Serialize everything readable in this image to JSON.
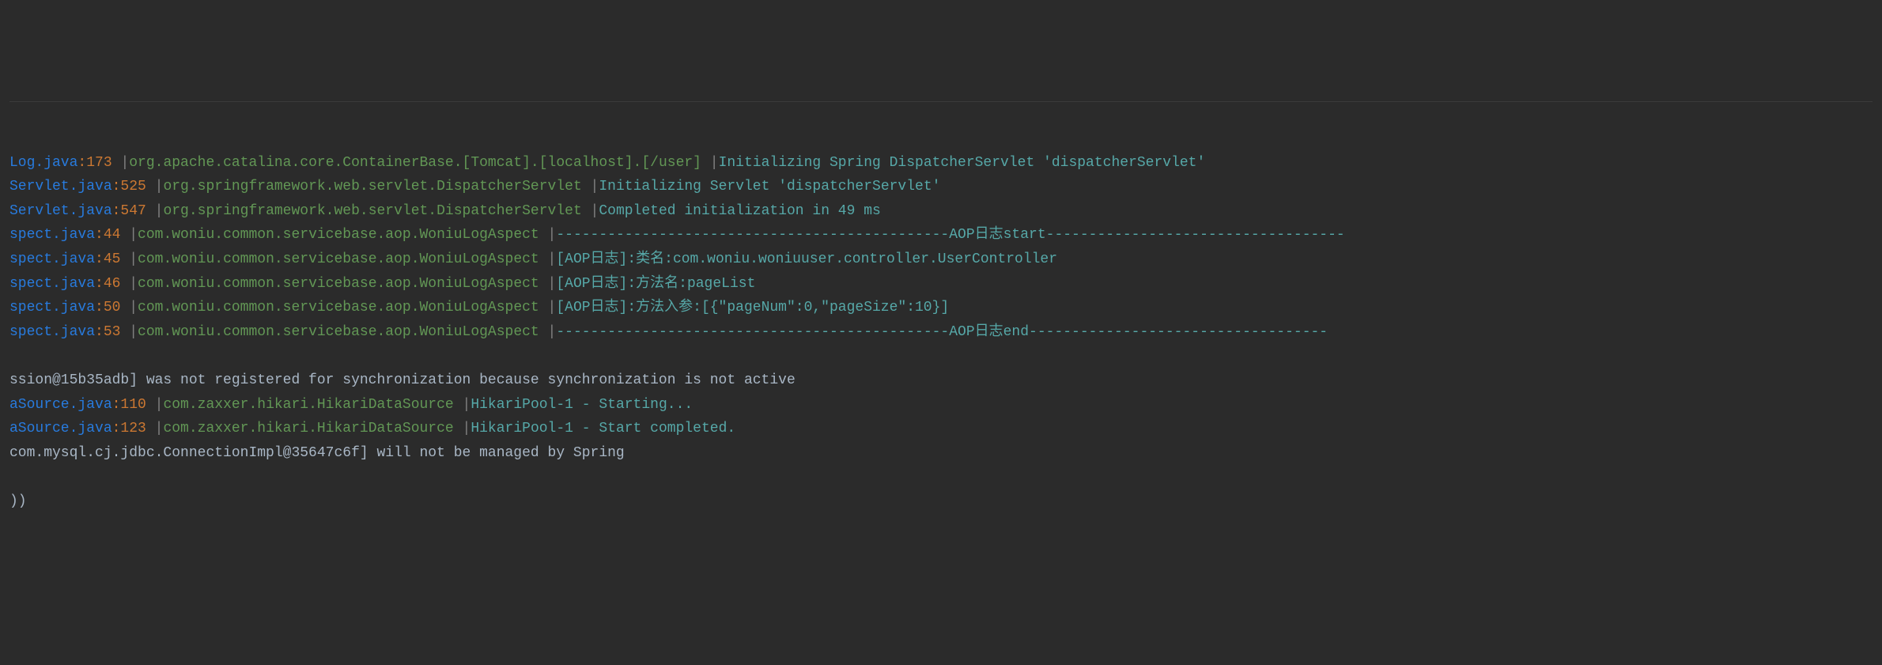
{
  "lines": [
    {
      "file": "Log.java",
      "lineNum": ":173",
      "logger": "org.apache.catalina.core.ContainerBase.[Tomcat].[localhost].[/user]",
      "message": "Initializing Spring DispatcherServlet 'dispatcherServlet'",
      "messageStyle": "info"
    },
    {
      "file": "Servlet.java",
      "lineNum": ":525",
      "logger": "org.springframework.web.servlet.DispatcherServlet",
      "message": "Initializing Servlet 'dispatcherServlet'",
      "messageStyle": "info"
    },
    {
      "file": "Servlet.java",
      "lineNum": ":547",
      "logger": "org.springframework.web.servlet.DispatcherServlet",
      "message": "Completed initialization in 49 ms",
      "messageStyle": "info"
    },
    {
      "file": "spect.java",
      "lineNum": ":44",
      "logger": "com.woniu.common.servicebase.aop.WoniuLogAspect",
      "message": "----------------------------------------------AOP日志start-----------------------------------",
      "messageStyle": "aop"
    },
    {
      "file": "spect.java",
      "lineNum": ":45",
      "logger": "com.woniu.common.servicebase.aop.WoniuLogAspect",
      "message": "[AOP日志]:类名:com.woniu.woniuuser.controller.UserController",
      "messageStyle": "aop"
    },
    {
      "file": "spect.java",
      "lineNum": ":46",
      "logger": "com.woniu.common.servicebase.aop.WoniuLogAspect",
      "message": "[AOP日志]:方法名:pageList",
      "messageStyle": "aop"
    },
    {
      "file": "spect.java",
      "lineNum": ":50",
      "logger": "com.woniu.common.servicebase.aop.WoniuLogAspect",
      "message": "[AOP日志]:方法入参:[{\"pageNum\":0,\"pageSize\":10}]",
      "messageStyle": "aop"
    },
    {
      "file": "spect.java",
      "lineNum": ":53",
      "logger": "com.woniu.common.servicebase.aop.WoniuLogAspect",
      "message": "----------------------------------------------AOP日志end-----------------------------------",
      "messageStyle": "aop"
    },
    {
      "plain": ""
    },
    {
      "plain": "ssion@15b35adb] was not registered for synchronization because synchronization is not active"
    },
    {
      "file": "aSource.java",
      "lineNum": ":110",
      "logger": "com.zaxxer.hikari.HikariDataSource",
      "message": "HikariPool-1 - Starting...",
      "messageStyle": "info"
    },
    {
      "file": "aSource.java",
      "lineNum": ":123",
      "logger": "com.zaxxer.hikari.HikariDataSource",
      "message": "HikariPool-1 - Start completed.",
      "messageStyle": "info"
    },
    {
      "plain": "com.mysql.cj.jdbc.ConnectionImpl@35647c6f] will not be managed by Spring"
    },
    {
      "plain": ""
    },
    {
      "plain": "))"
    }
  ]
}
